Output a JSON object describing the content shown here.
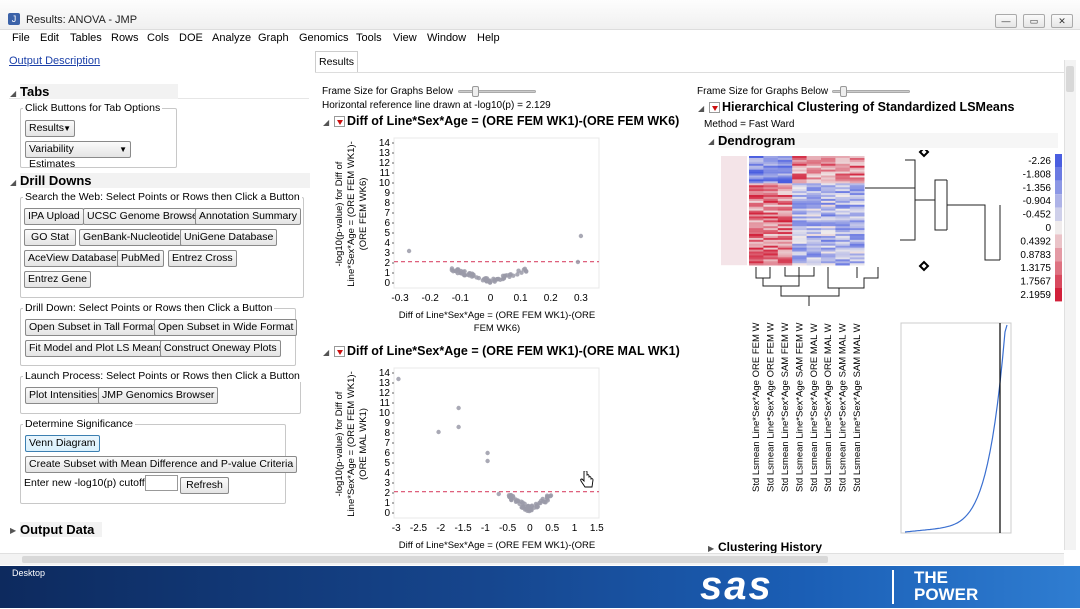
{
  "window": {
    "title": "Results: ANOVA - JMP",
    "controls": [
      "—",
      "▭",
      "✕"
    ]
  },
  "menu": [
    "File",
    "Edit",
    "Tables",
    "Rows",
    "Cols",
    "DOE",
    "Analyze",
    "Graph",
    "Genomics",
    "Tools",
    "View",
    "Window",
    "Help"
  ],
  "left": {
    "output_description": "Output Description",
    "tabs_header": "Tabs",
    "tab_options_label": "Click Buttons for Tab Options",
    "results_combo": "Results",
    "variability_combo": "Variability Estimates",
    "drill_header": "Drill Downs",
    "search_web_label": "Search the Web: Select Points or Rows then Click a Button",
    "web_buttons": [
      [
        "IPA Upload",
        "UCSC Genome Browser",
        "Annotation Summary"
      ],
      [
        "GO Stat",
        "GenBank-Nucleotide",
        "UniGene Database"
      ],
      [
        "AceView Database",
        "PubMed",
        "Entrez Cross"
      ],
      [
        "Entrez Gene"
      ]
    ],
    "drill_label": "Drill Down: Select Points or Rows then Click a Button",
    "drill_buttons": [
      [
        "Open Subset in Tall Format",
        "Open Subset in Wide Format"
      ],
      [
        "Fit Model and Plot LS Means",
        "Construct Oneway Plots"
      ]
    ],
    "launch_label": "Launch Process: Select Points or Rows then Click a Button",
    "launch_buttons": [
      "Plot Intensities",
      "JMP Genomics Browser"
    ],
    "significance_label": "Determine Significance",
    "venn_button": "Venn Diagram",
    "subset_button": "Create Subset with Mean Difference and P-value Criteria",
    "cutoff_label": "Enter new -log10(p) cutoff",
    "cutoff_value": "",
    "refresh_button": "Refresh",
    "output_data_header": "Output Data"
  },
  "results_tab": "Results",
  "middle": {
    "frame_size_label": "Frame Size for Graphs Below",
    "refline_text": "Horizontal reference line drawn at -log10(p) = 2.129",
    "plot1_title": "Diff of Line*Sex*Age = (ORE FEM WK1)-(ORE FEM WK6)",
    "plot1_ylabel": [
      "-log10(p-value) for Diff of",
      "Line*Sex*Age = (ORE FEM WK1)-",
      "(ORE FEM WK6)"
    ],
    "plot1_xlabel": [
      "Diff of Line*Sex*Age = (ORE FEM WK1)-(ORE",
      "FEM WK6)"
    ],
    "plot1_xticks": [
      "-0.3",
      "-0.2",
      "-0.1",
      "0",
      "0.1",
      "0.2",
      "0.3"
    ],
    "plot2_title": "Diff of Line*Sex*Age = (ORE FEM WK1)-(ORE MAL WK1)",
    "plot2_ylabel": [
      "-log10(p-value) for Diff of",
      "Line*Sex*Age = (ORE FEM WK1)-",
      "(ORE MAL WK1)"
    ],
    "plot2_xlabel": [
      "Diff of Line*Sex*Age = (ORE FEM WK1)-(ORE"
    ],
    "plot2_xticks": [
      "-3",
      "-2.5",
      "-2",
      "-1.5",
      "-1",
      "-0.5",
      "0",
      "0.5",
      "1",
      "1.5"
    ],
    "yticks": [
      "14",
      "13",
      "12",
      "11",
      "10",
      "9",
      "8",
      "7",
      "6",
      "5",
      "4",
      "3",
      "2",
      "1",
      "0"
    ]
  },
  "right": {
    "frame_size_label": "Frame Size for Graphs Below",
    "cluster_title": "Hierarchical Clustering of Standardized LSMeans",
    "method_text": "Method =  Fast Ward",
    "dendrogram_header": "Dendrogram",
    "legend": [
      "-2.26",
      "-1.808",
      "-1.356",
      "-0.904",
      "-0.452",
      "0",
      "0.4392",
      "0.8783",
      "1.3175",
      "1.7567",
      "2.1959"
    ],
    "columns": [
      "Std Lsmean Line*Sex*Age ORE FEM W",
      "Std Lsmean Line*Sex*Age ORE FEM W",
      "Std Lsmean Line*Sex*Age SAM FEM W",
      "Std Lsmean Line*Sex*Age SAM FEM W",
      "Std Lsmean Line*Sex*Age ORE MAL W",
      "Std Lsmean Line*Sex*Age ORE MAL W",
      "Std Lsmean Line*Sex*Age SAM MAL W",
      "Std Lsmean Line*Sex*Age SAM MAL W"
    ],
    "clustering_history": "Clustering History"
  },
  "colors": {
    "link": "#1a3fa8",
    "refline": "#d94b6b",
    "point": "#9a9aa8",
    "heat_low": "#4a5ee0",
    "heat_high": "#d2203a",
    "banner": "#16468e"
  },
  "taskbar": {
    "desktop_label": "Desktop"
  },
  "banner": {
    "brand": "sas",
    "tagline_1": "THE",
    "tagline_2": "POWER"
  }
}
